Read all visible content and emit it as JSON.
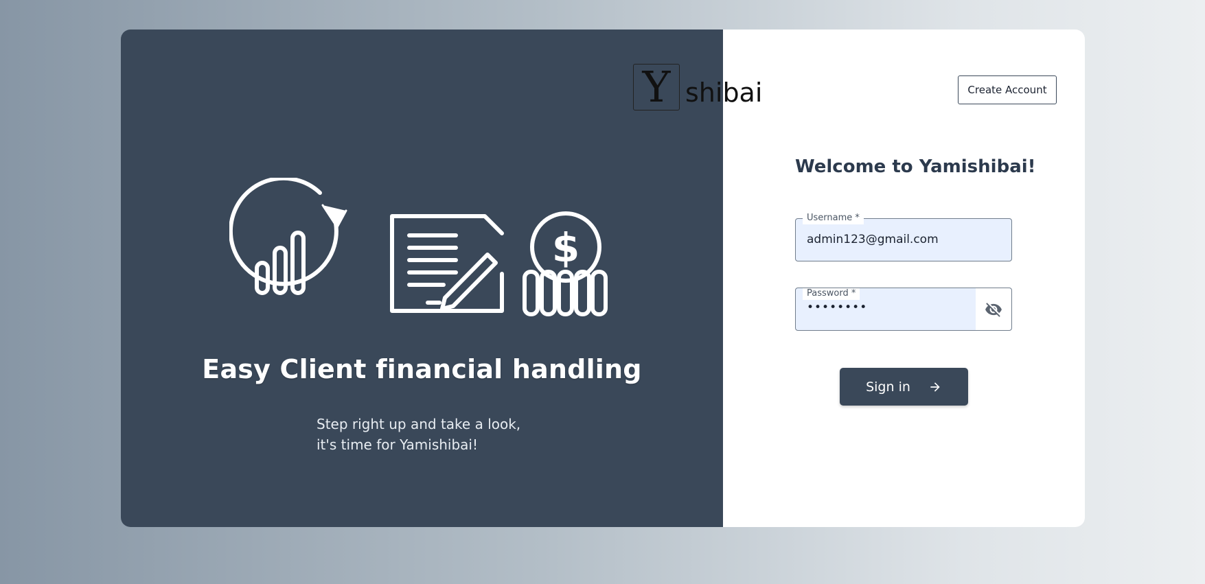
{
  "left_panel": {
    "tagline": "Easy Client financial handling",
    "subtext": "Step right up and take a look, it's time for Yamishibai!",
    "icons": [
      "chart-refresh-icon",
      "document-edit-icon",
      "dollar-coins-icon"
    ]
  },
  "logo": {
    "letter": "Y",
    "text": "shibai"
  },
  "header": {
    "create_account_label": "Create Account"
  },
  "form": {
    "welcome": "Welcome to Yamishibai!",
    "username": {
      "label": "Username *",
      "value": "admin123@gmail.com"
    },
    "password": {
      "label": "Password *",
      "value": "••••••••",
      "toggle_icon": "eye-off-icon"
    },
    "signin_label": "Sign in"
  },
  "colors": {
    "panel": "#3a4859",
    "input_fill": "#e8f0fe",
    "heading": "#2c3a4d"
  }
}
